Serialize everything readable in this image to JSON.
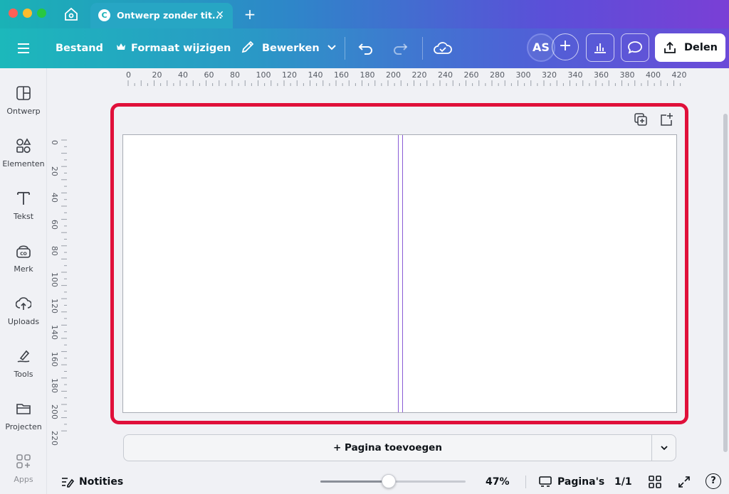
{
  "window": {
    "tab_title": "Ontwerp zonder tit...",
    "tab_logo": "C",
    "tab_close": "✕",
    "new_tab": "+"
  },
  "toolbar": {
    "file_label": "Bestand",
    "resize_label": "Formaat wijzigen",
    "edit_label": "Bewerken",
    "avatar_initials": "AS",
    "invite_symbol": "+",
    "share_label": "Delen"
  },
  "sidebar": {
    "items": [
      {
        "label": "Ontwerp",
        "icon": "design-icon"
      },
      {
        "label": "Elementen",
        "icon": "elements-icon"
      },
      {
        "label": "Tekst",
        "icon": "text-icon"
      },
      {
        "label": "Merk",
        "icon": "brand-icon"
      },
      {
        "label": "Uploads",
        "icon": "upload-icon"
      },
      {
        "label": "Tools",
        "icon": "tools-icon"
      },
      {
        "label": "Projecten",
        "icon": "folder-icon"
      },
      {
        "label": "Apps",
        "icon": "apps-icon"
      }
    ]
  },
  "rulers": {
    "horizontal": [
      "0",
      "20",
      "40",
      "60",
      "80",
      "100",
      "120",
      "140",
      "160",
      "180",
      "200",
      "220",
      "240",
      "260",
      "280",
      "300",
      "320",
      "340",
      "360",
      "380",
      "400",
      "420"
    ],
    "vertical": [
      "0",
      "20",
      "40",
      "60",
      "80",
      "100",
      "120",
      "140",
      "160",
      "180",
      "200",
      "220"
    ]
  },
  "canvas": {
    "add_page_label": "+ Pagina toevoegen"
  },
  "footer": {
    "notes_label": "Notities",
    "zoom_value": "47%",
    "zoom_fraction": 0.47,
    "pages_label": "Pagina's",
    "page_count": "1/1",
    "help_symbol": "?"
  },
  "colors": {
    "highlight": "#e0103a",
    "spine": "#8a5cd6",
    "toolbar_start": "#1cb8bb",
    "toolbar_end": "#6b4ad8"
  }
}
